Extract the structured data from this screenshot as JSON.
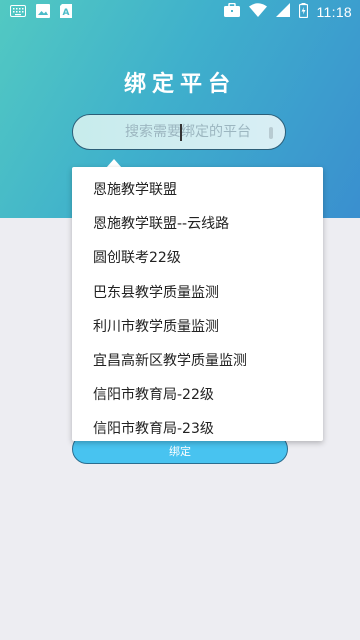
{
  "status_bar": {
    "time": "11:18",
    "icons": [
      "keyboard-icon",
      "image-icon",
      "sim-app-icon",
      "briefcase-icon",
      "wifi-icon",
      "signal-icon",
      "battery-charging-icon"
    ]
  },
  "page": {
    "title": "绑定平台"
  },
  "search": {
    "placeholder": "搜索需要绑定的平台"
  },
  "dropdown": {
    "items": [
      "恩施教学联盟",
      "恩施教学联盟--云线路",
      "圆创联考22级",
      "巴东县教学质量监测",
      "利川市教学质量监测",
      "宜昌高新区教学质量监测",
      "信阳市教育局-22级",
      "信阳市教育局-23级"
    ]
  },
  "bind_button": {
    "label": "绑定"
  },
  "colors": {
    "header_gradient_start": "#52c9c2",
    "header_gradient_end": "#3a8fcf",
    "button": "#48c3f0",
    "background": "#ededf2"
  }
}
